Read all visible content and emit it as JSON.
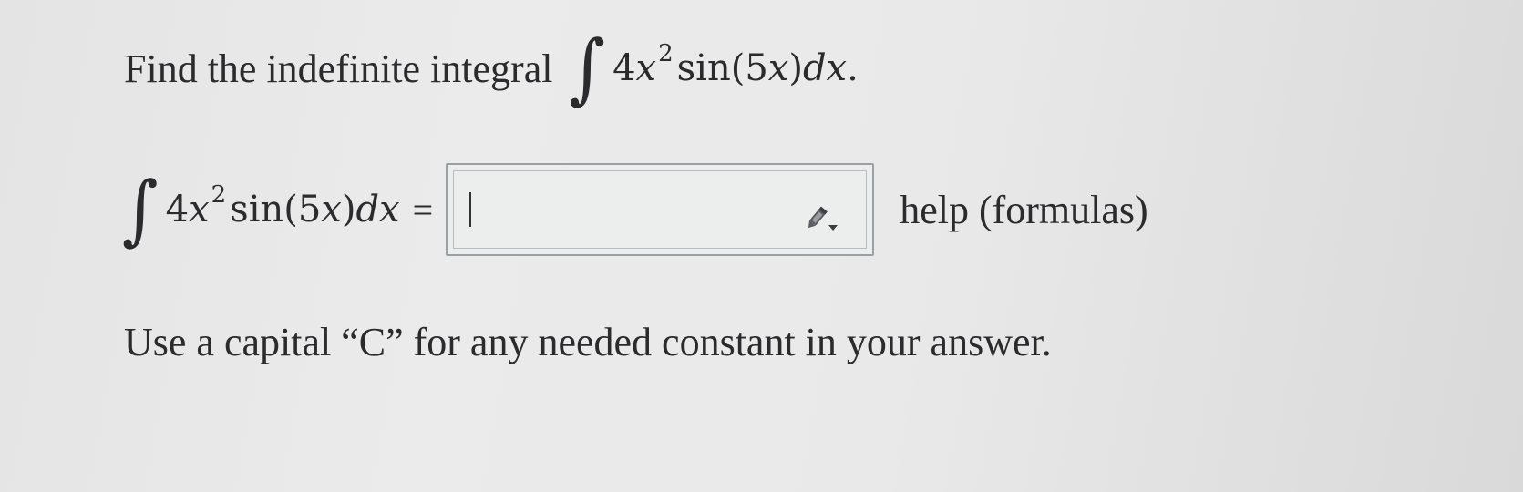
{
  "question": {
    "prompt_text": "Find the indefinite integral",
    "integral_symbol": "∫",
    "coefficient": "4",
    "variable": "x",
    "exponent": "2",
    "function": "sin(5",
    "function_var": "x",
    "function_close": ")",
    "differential": "d",
    "differential_var": "x",
    "end_punctuation": "."
  },
  "answer": {
    "equals": "=",
    "input_value": "",
    "editor_icon": "pencil-dropdown-icon",
    "help_link": "help (formulas)"
  },
  "note": {
    "text": "Use a capital “C” for any needed constant in your answer."
  },
  "colors": {
    "text": "#2b2a2c",
    "box_border": "#9aa1a5",
    "background": "#e8e8e8"
  }
}
